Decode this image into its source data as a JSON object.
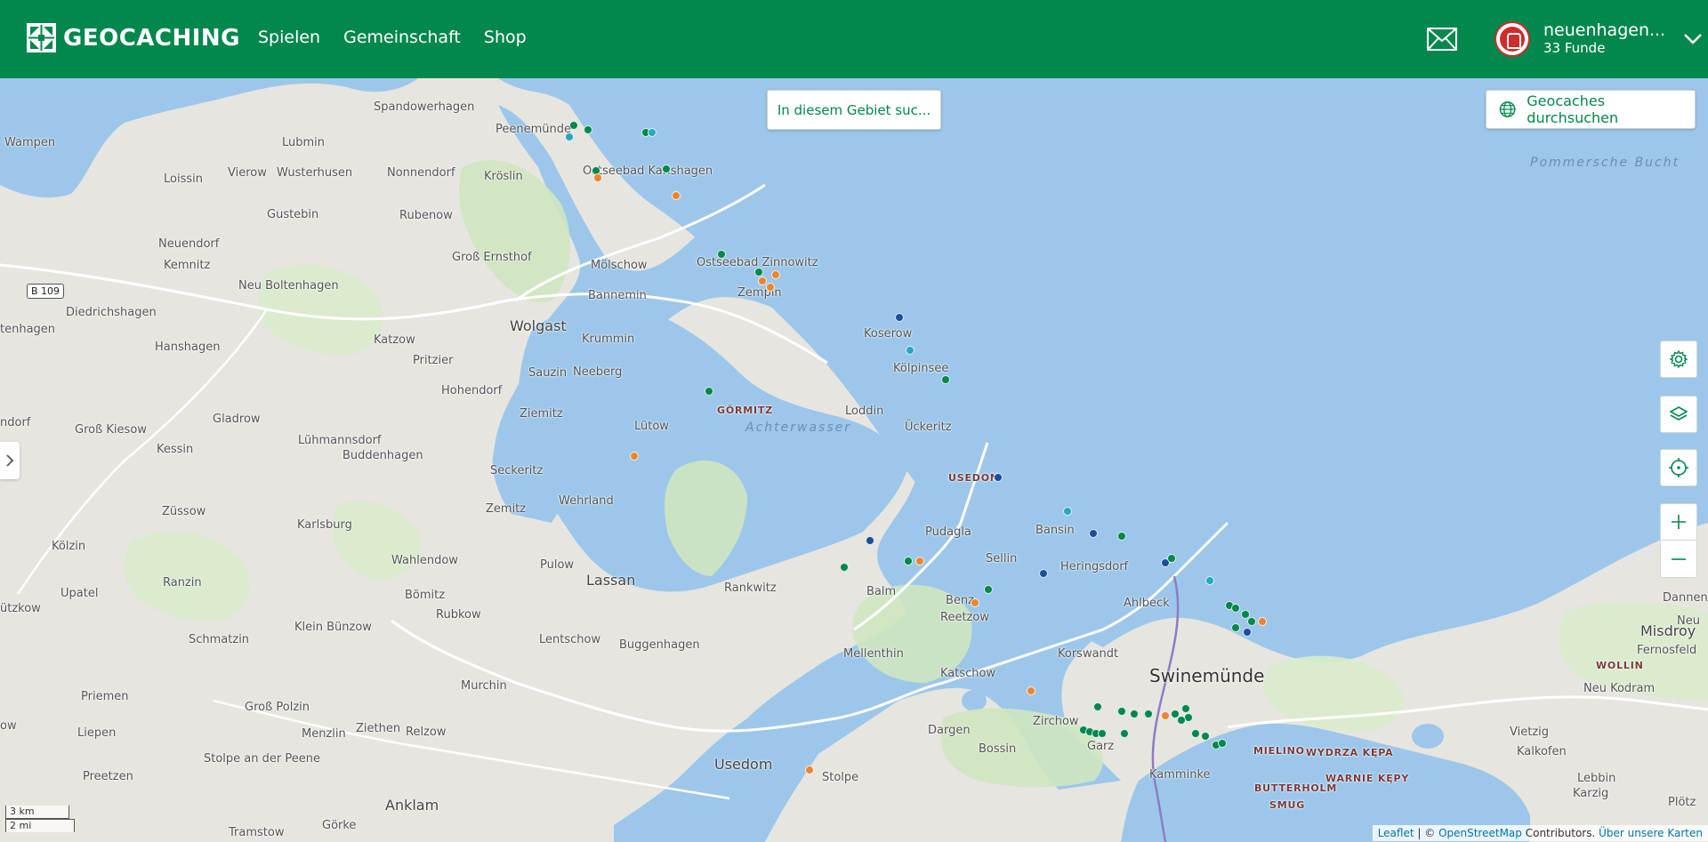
{
  "header": {
    "logo_text": "GEOCACHING",
    "nav": [
      "Spielen",
      "Gemeinschaft",
      "Shop"
    ],
    "user_name": "neuenhagen...",
    "user_finds": "33 Funde"
  },
  "map_controls": {
    "search_area_label": "In diesem Gebiet suc...",
    "browse_label": "Geocaches durchsuchen",
    "scale_km": "3 km",
    "scale_mi": "2 mi"
  },
  "attribution": {
    "leaflet": "Leaflet",
    "sep": " | © ",
    "osm": "OpenStreetMap",
    "contributors": " Contributors. ",
    "about": "Über unsere Karten"
  },
  "colors": {
    "brand": "#02874d",
    "cache_traditional": "#02874d",
    "cache_mystery": "#1c4e9b",
    "cache_multi": "#e98631",
    "cache_earth": "#26a7c3"
  },
  "places": [
    {
      "name": "Spandowerhagen",
      "cls": ""
    },
    {
      "name": "Peenemünde",
      "cls": ""
    },
    {
      "name": "Wampen",
      "cls": ""
    },
    {
      "name": "Lubmin",
      "cls": ""
    },
    {
      "name": "Loissin",
      "cls": ""
    },
    {
      "name": "Vierow",
      "cls": ""
    },
    {
      "name": "Wusterhusen",
      "cls": ""
    },
    {
      "name": "Nonnendorf",
      "cls": ""
    },
    {
      "name": "Kröslin",
      "cls": ""
    },
    {
      "name": "Ostseebad Karlshagen",
      "cls": ""
    },
    {
      "name": "Rubenow",
      "cls": ""
    },
    {
      "name": "Gustebin",
      "cls": ""
    },
    {
      "name": "Neuendorf",
      "cls": ""
    },
    {
      "name": "Kemnitz",
      "cls": ""
    },
    {
      "name": "Groß Ernsthof",
      "cls": ""
    },
    {
      "name": "Mölschow",
      "cls": ""
    },
    {
      "name": "Ostseebad Zinnowitz",
      "cls": ""
    },
    {
      "name": "Neu Boltenhagen",
      "cls": ""
    },
    {
      "name": "Bannemin",
      "cls": ""
    },
    {
      "name": "Zempin",
      "cls": ""
    },
    {
      "name": "Diedrichshagen",
      "cls": ""
    },
    {
      "name": "Wolgast",
      "cls": "mid"
    },
    {
      "name": "Koserow",
      "cls": ""
    },
    {
      "name": "Hanshagen",
      "cls": ""
    },
    {
      "name": "Katzow",
      "cls": ""
    },
    {
      "name": "Krummin",
      "cls": ""
    },
    {
      "name": "Pritzier",
      "cls": ""
    },
    {
      "name": "Neeberg",
      "cls": ""
    },
    {
      "name": "Sauzin",
      "cls": ""
    },
    {
      "name": "Kölpinsee",
      "cls": ""
    },
    {
      "name": "Hohendorf",
      "cls": ""
    },
    {
      "name": "GÖRMITZ",
      "cls": "caps"
    },
    {
      "name": "Loddin",
      "cls": ""
    },
    {
      "name": "Ziemitz",
      "cls": ""
    },
    {
      "name": "Gladrow",
      "cls": ""
    },
    {
      "name": "Lütow",
      "cls": ""
    },
    {
      "name": "Achterwasser",
      "cls": "water"
    },
    {
      "name": "Ückeritz",
      "cls": ""
    },
    {
      "name": "Groß Kiesow",
      "cls": ""
    },
    {
      "name": "Lühmannsdorf",
      "cls": ""
    },
    {
      "name": "Kessin",
      "cls": ""
    },
    {
      "name": "Buddenhagen",
      "cls": ""
    },
    {
      "name": "Seckeritz",
      "cls": ""
    },
    {
      "name": "USEDOM",
      "cls": "caps"
    },
    {
      "name": "Wehrland",
      "cls": ""
    },
    {
      "name": "Züssow",
      "cls": ""
    },
    {
      "name": "Zemitz",
      "cls": ""
    },
    {
      "name": "Karlsburg",
      "cls": ""
    },
    {
      "name": "Pudagla",
      "cls": ""
    },
    {
      "name": "Bansin",
      "cls": ""
    },
    {
      "name": "Kölzin",
      "cls": ""
    },
    {
      "name": "Wahlendow",
      "cls": ""
    },
    {
      "name": "Pulow",
      "cls": ""
    },
    {
      "name": "Sellin",
      "cls": ""
    },
    {
      "name": "Heringsdorf",
      "cls": ""
    },
    {
      "name": "Lassan",
      "cls": "mid"
    },
    {
      "name": "Ranzin",
      "cls": ""
    },
    {
      "name": "Rankwitz",
      "cls": ""
    },
    {
      "name": "Balm",
      "cls": ""
    },
    {
      "name": "Upatel",
      "cls": ""
    },
    {
      "name": "Bömitz",
      "cls": ""
    },
    {
      "name": "Benz",
      "cls": ""
    },
    {
      "name": "Ahlbeck",
      "cls": ""
    },
    {
      "name": "Rubkow",
      "cls": ""
    },
    {
      "name": "Reetzow",
      "cls": ""
    },
    {
      "name": "Klein Bünzow",
      "cls": ""
    },
    {
      "name": "Schmatzin",
      "cls": ""
    },
    {
      "name": "Lentschow",
      "cls": ""
    },
    {
      "name": "Buggenhagen",
      "cls": ""
    },
    {
      "name": "Mellenthin",
      "cls": ""
    },
    {
      "name": "Korswandt",
      "cls": ""
    },
    {
      "name": "Katschow",
      "cls": ""
    },
    {
      "name": "Swinemünde",
      "cls": "big"
    },
    {
      "name": "Murchin",
      "cls": ""
    },
    {
      "name": "Priemen",
      "cls": ""
    },
    {
      "name": "Groß Polzin",
      "cls": ""
    },
    {
      "name": "Zirchow",
      "cls": ""
    },
    {
      "name": "Ziethen",
      "cls": ""
    },
    {
      "name": "Relzow",
      "cls": ""
    },
    {
      "name": "Liepen",
      "cls": ""
    },
    {
      "name": "Menzlin",
      "cls": ""
    },
    {
      "name": "Dargen",
      "cls": ""
    },
    {
      "name": "Garz",
      "cls": ""
    },
    {
      "name": "Stolpe an der Peene",
      "cls": ""
    },
    {
      "name": "Bossin",
      "cls": ""
    },
    {
      "name": "Usedom",
      "cls": "mid"
    },
    {
      "name": "Kamminke",
      "cls": ""
    },
    {
      "name": "Preetzen",
      "cls": ""
    },
    {
      "name": "Stolpe",
      "cls": ""
    },
    {
      "name": "Anklam",
      "cls": "mid"
    },
    {
      "name": "Tramstow",
      "cls": ""
    },
    {
      "name": "Görke",
      "cls": ""
    },
    {
      "name": "Misdroy",
      "cls": "mid"
    },
    {
      "name": "Fernosfeld",
      "cls": ""
    },
    {
      "name": "Dannenbe",
      "cls": ""
    },
    {
      "name": "Neu",
      "cls": ""
    },
    {
      "name": "WOLLIN",
      "cls": "caps"
    },
    {
      "name": "Neu Kodram",
      "cls": ""
    },
    {
      "name": "MIELINO",
      "cls": "caps"
    },
    {
      "name": "WYDRZA KĘPA",
      "cls": "caps"
    },
    {
      "name": "Vietzig",
      "cls": ""
    },
    {
      "name": "Kalkofen",
      "cls": ""
    },
    {
      "name": "WARNIE KĘPY",
      "cls": "caps"
    },
    {
      "name": "Lebbin",
      "cls": ""
    },
    {
      "name": "BUTTERHOLM",
      "cls": "caps"
    },
    {
      "name": "SMUG",
      "cls": "caps"
    },
    {
      "name": "Karzig",
      "cls": ""
    },
    {
      "name": "Plötz",
      "cls": ""
    },
    {
      "name": "Pommersche Bucht",
      "cls": "water"
    },
    {
      "name": "tenhagen",
      "cls": ""
    },
    {
      "name": "ützkow",
      "cls": ""
    },
    {
      "name": "ndorf",
      "cls": ""
    },
    {
      "name": "ow",
      "cls": ""
    }
  ],
  "road_label": "B 109",
  "caches": [
    {
      "type": "traditional",
      "lon": 13.864,
      "lat": 54.143
    },
    {
      "type": "traditional",
      "lon": 13.878,
      "lat": 54.14
    },
    {
      "type": "earth",
      "lon": 13.86,
      "lat": 54.135
    },
    {
      "type": "traditional",
      "lon": 13.935,
      "lat": 54.138
    },
    {
      "type": "earth",
      "lon": 13.941,
      "lat": 54.138
    },
    {
      "type": "traditional",
      "lon": 13.886,
      "lat": 54.112
    },
    {
      "type": "multi",
      "lon": 13.888,
      "lat": 54.107
    },
    {
      "type": "traditional",
      "lon": 13.955,
      "lat": 54.113
    },
    {
      "type": "multi",
      "lon": 13.965,
      "lat": 54.095
    },
    {
      "type": "traditional",
      "lon": 14.01,
      "lat": 54.055
    },
    {
      "type": "traditional",
      "lon": 14.046,
      "lat": 54.043
    },
    {
      "type": "multi",
      "lon": 14.05,
      "lat": 54.037
    },
    {
      "type": "multi",
      "lon": 14.063,
      "lat": 54.041
    },
    {
      "type": "multi",
      "lon": 14.058,
      "lat": 54.033
    },
    {
      "type": "mystery",
      "lon": 14.185,
      "lat": 54.012
    },
    {
      "type": "earth",
      "lon": 14.195,
      "lat": 53.99
    },
    {
      "type": "traditional",
      "lon": 14.23,
      "lat": 53.97
    },
    {
      "type": "traditional",
      "lon": 13.997,
      "lat": 53.962
    },
    {
      "type": "multi",
      "lon": 13.924,
      "lat": 53.918
    },
    {
      "type": "mystery",
      "lon": 14.282,
      "lat": 53.903
    },
    {
      "type": "earth",
      "lon": 14.35,
      "lat": 53.88
    },
    {
      "type": "mystery",
      "lon": 14.375,
      "lat": 53.865
    },
    {
      "type": "traditional",
      "lon": 14.403,
      "lat": 53.863
    },
    {
      "type": "mystery",
      "lon": 14.156,
      "lat": 53.86
    },
    {
      "type": "traditional",
      "lon": 14.13,
      "lat": 53.842
    },
    {
      "type": "traditional",
      "lon": 14.193,
      "lat": 53.846
    },
    {
      "type": "multi",
      "lon": 14.205,
      "lat": 53.846
    },
    {
      "type": "mystery",
      "lon": 14.326,
      "lat": 53.838
    },
    {
      "type": "mystery",
      "lon": 14.446,
      "lat": 53.845
    },
    {
      "type": "traditional",
      "lon": 14.452,
      "lat": 53.848
    },
    {
      "type": "earth",
      "lon": 14.49,
      "lat": 53.833
    },
    {
      "type": "traditional",
      "lon": 14.272,
      "lat": 53.827
    },
    {
      "type": "multi",
      "lon": 14.259,
      "lat": 53.818
    },
    {
      "type": "traditional",
      "lon": 14.509,
      "lat": 53.816
    },
    {
      "type": "traditional",
      "lon": 14.515,
      "lat": 53.814
    },
    {
      "type": "traditional",
      "lon": 14.525,
      "lat": 53.81
    },
    {
      "type": "traditional",
      "lon": 14.531,
      "lat": 53.805
    },
    {
      "type": "multi",
      "lon": 14.542,
      "lat": 53.805
    },
    {
      "type": "traditional",
      "lon": 14.515,
      "lat": 53.801
    },
    {
      "type": "mystery",
      "lon": 14.527,
      "lat": 53.798
    },
    {
      "type": "multi",
      "lon": 14.314,
      "lat": 53.758
    },
    {
      "type": "traditional",
      "lon": 14.38,
      "lat": 53.747
    },
    {
      "type": "traditional",
      "lon": 14.403,
      "lat": 53.744
    },
    {
      "type": "traditional",
      "lon": 14.416,
      "lat": 53.742
    },
    {
      "type": "traditional",
      "lon": 14.43,
      "lat": 53.742
    },
    {
      "type": "multi",
      "lon": 14.446,
      "lat": 53.741
    },
    {
      "type": "traditional",
      "lon": 14.456,
      "lat": 53.742
    },
    {
      "type": "traditional",
      "lon": 14.466,
      "lat": 53.746
    },
    {
      "type": "traditional",
      "lon": 14.469,
      "lat": 53.74
    },
    {
      "type": "traditional",
      "lon": 14.462,
      "lat": 53.738
    },
    {
      "type": "traditional",
      "lon": 14.366,
      "lat": 53.731
    },
    {
      "type": "traditional",
      "lon": 14.372,
      "lat": 53.73
    },
    {
      "type": "traditional",
      "lon": 14.378,
      "lat": 53.729
    },
    {
      "type": "traditional",
      "lon": 14.384,
      "lat": 53.729
    },
    {
      "type": "traditional",
      "lon": 14.406,
      "lat": 53.729
    },
    {
      "type": "traditional",
      "lon": 14.476,
      "lat": 53.729
    },
    {
      "type": "traditional",
      "lon": 14.486,
      "lat": 53.727
    },
    {
      "type": "traditional",
      "lon": 14.496,
      "lat": 53.721
    },
    {
      "type": "traditional",
      "lon": 14.502,
      "lat": 53.722
    },
    {
      "type": "multi",
      "lon": 14.096,
      "lat": 53.704
    }
  ]
}
